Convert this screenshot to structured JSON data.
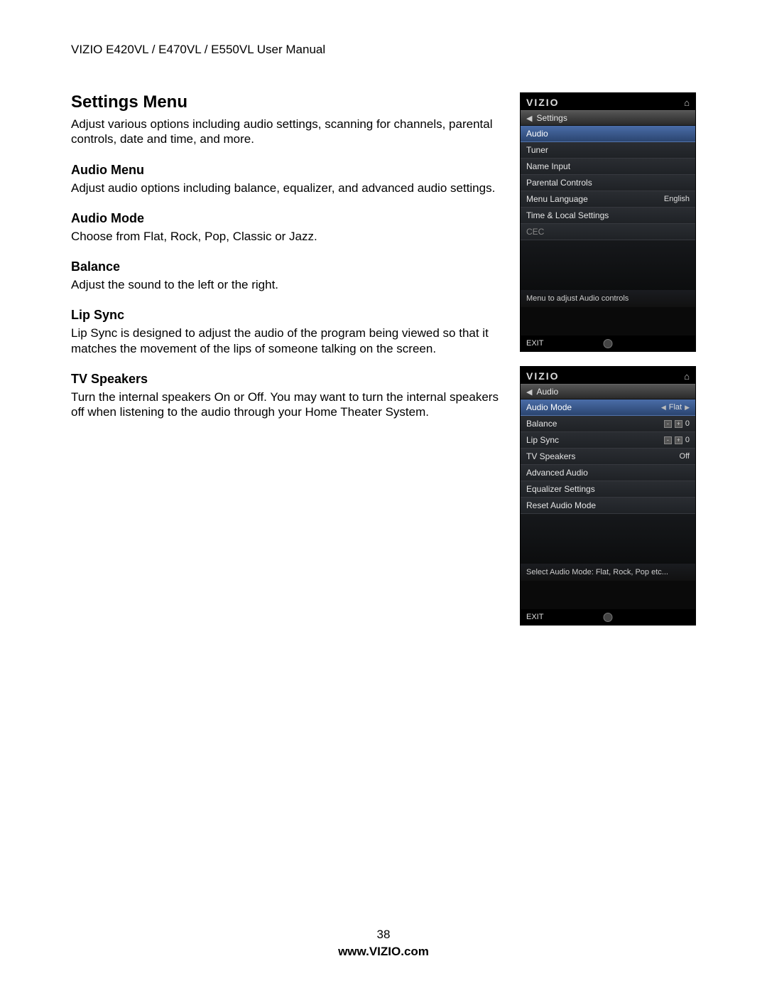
{
  "header": "VIZIO E420VL / E470VL / E550VL User Manual",
  "main": {
    "title": "Settings Menu",
    "intro": "Adjust various options including audio settings, scanning for channels, parental controls, date and time, and more.",
    "sections": [
      {
        "title": "Audio Menu",
        "body": "Adjust audio options including balance, equalizer, and advanced audio settings."
      },
      {
        "title": "Audio Mode",
        "body": "Choose from Flat, Rock, Pop, Classic or Jazz."
      },
      {
        "title": "Balance",
        "body": "Adjust the sound to the left or the right."
      },
      {
        "title": "Lip Sync",
        "body": "Lip Sync is designed to adjust the audio of the program being viewed so that it matches the movement of the lips of someone talking on the screen."
      },
      {
        "title": "TV Speakers",
        "body": "Turn the internal speakers On or Off. You may want to turn the internal speakers off when listening to the audio through your Home Theater System."
      }
    ]
  },
  "osd1": {
    "brand": "VIZIO",
    "crumb": "Settings",
    "rows": [
      {
        "label": "Audio",
        "value": "",
        "sel": true
      },
      {
        "label": "Tuner",
        "value": ""
      },
      {
        "label": "Name Input",
        "value": ""
      },
      {
        "label": "Parental Controls",
        "value": ""
      },
      {
        "label": "Menu Language",
        "value": "English"
      },
      {
        "label": "Time & Local Settings",
        "value": ""
      },
      {
        "label": "CEC",
        "value": "",
        "dim": true
      }
    ],
    "hint": "Menu to adjust Audio controls",
    "exit": "EXIT"
  },
  "osd2": {
    "brand": "VIZIO",
    "crumb": "Audio",
    "rows": [
      {
        "label": "Audio Mode",
        "value": "Flat",
        "sel": true,
        "arrows": true
      },
      {
        "label": "Balance",
        "value": "0",
        "slider": true
      },
      {
        "label": "Lip Sync",
        "value": "0",
        "slider": true
      },
      {
        "label": "TV Speakers",
        "value": "Off"
      },
      {
        "label": "Advanced Audio",
        "value": ""
      },
      {
        "label": "Equalizer Settings",
        "value": ""
      },
      {
        "label": "Reset Audio Mode",
        "value": ""
      }
    ],
    "hint": "Select Audio Mode: Flat, Rock, Pop etc...",
    "exit": "EXIT"
  },
  "footer": {
    "page": "38",
    "site": "www.VIZIO.com"
  }
}
